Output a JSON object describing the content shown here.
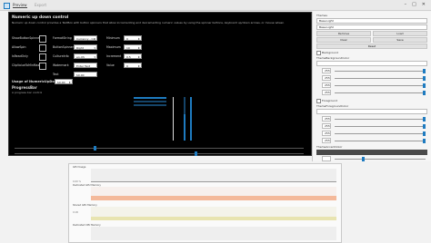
{
  "topbar": {
    "tabs": [
      "Preview",
      "Export"
    ]
  },
  "demo": {
    "title": "Numeric up down control",
    "description": "Numeric up down control provides a TextBox with button spinners that allow incrementing and decrementing numeric values by using the spinner buttons, keyboard up/down arrows, or mouse wheel.",
    "rows_left": [
      "ShowButtonSpinner",
      "AllowSpin",
      "IsReadOnly",
      "ClipValueToMinMax"
    ],
    "rows_mid": [
      "FormatString",
      "ButtonSpinnerLocation",
      "CultureInfo",
      "Watermark",
      "Text"
    ],
    "mid_values": [
      "Currency - C2",
      "Right",
      "en-US",
      "Enter Text",
      "$0.00"
    ],
    "rows_right": [
      "Minimum",
      "Maximum",
      "Increment",
      "Value"
    ],
    "right_values": [
      "0",
      "10",
      "0.5",
      "0"
    ],
    "usage_label": "Usage of NumericUpDown:",
    "usage_value": "$0.00",
    "progress_title": "ProgressBar",
    "progress_sub": "A progress bar control"
  },
  "tools": {
    "theme_label": "Themes",
    "theme_value": "Base.Light",
    "field2": "Base.Light",
    "btn_remove": "Remove",
    "btn_load": "Load",
    "btn_clear": "Clear",
    "btn_save": "Save",
    "btn_reset": "Reset",
    "bg_label": "Background",
    "bg_sub": "ThemeBackgroundColor",
    "bg_vals": [
      "255",
      "255",
      "255",
      "255"
    ],
    "fg_label": "Foreground",
    "fg_sub": "ThemeForegroundColor",
    "fg_vals": [
      "255",
      "255",
      "255",
      "255"
    ],
    "accent_sub": "ThemeAccentColor"
  },
  "profiler": {
    "rows": [
      "GPU Usage",
      "Dedicated GPU Memory",
      "Shared GPU Memory",
      "Dedicated CPU Memory"
    ],
    "values": [
      "0.00 %",
      "",
      "0 kB",
      ""
    ]
  },
  "colors": {
    "accent": "#1e7bc0",
    "memory": "#f4b99a",
    "shared": "#e8e4b0"
  }
}
